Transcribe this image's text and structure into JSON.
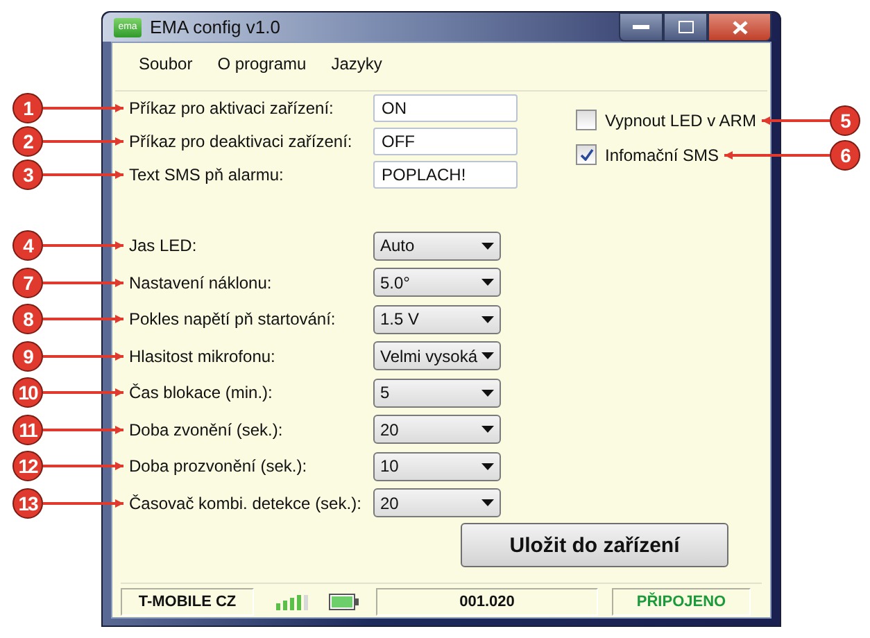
{
  "window": {
    "title": "EMA config v1.0",
    "icon_text": "ema"
  },
  "menu": [
    "Soubor",
    "O programu",
    "Jazyky"
  ],
  "text_fields": [
    {
      "callout": "1",
      "label": "Příkaz pro aktivaci zařízení:",
      "value": "ON"
    },
    {
      "callout": "2",
      "label": "Příkaz pro deaktivaci zařízení:",
      "value": "OFF"
    },
    {
      "callout": "3",
      "label": "Text SMS pň alarmu:",
      "value": "POPLACH!"
    }
  ],
  "checkboxes": [
    {
      "callout": "5",
      "label": "Vypnout LED v ARM",
      "checked": false
    },
    {
      "callout": "6",
      "label": "Infomační SMS",
      "checked": true
    }
  ],
  "dropdowns": [
    {
      "callout": "4",
      "label": "Jas LED:",
      "value": "Auto"
    },
    {
      "callout": "7",
      "label": "Nastavení náklonu:",
      "value": "5.0°"
    },
    {
      "callout": "8",
      "label": "Pokles napětí pň startování:",
      "value": "1.5 V"
    },
    {
      "callout": "9",
      "label": "Hlasitost mikrofonu:",
      "value": "Velmi vysoká"
    },
    {
      "callout": "10",
      "label": "Čas blokace (min.):",
      "value": "5"
    },
    {
      "callout": "11",
      "label": "Doba zvonění (sek.):",
      "value": "20"
    },
    {
      "callout": "12",
      "label": "Doba prozvonění (sek.):",
      "value": "10"
    },
    {
      "callout": "13",
      "label": "Časovač kombi. detekce (sek.):",
      "value": "20"
    }
  ],
  "save_button": "Uložit do zařízení",
  "status_bar": {
    "operator": "T-MOBILE CZ",
    "version": "001.020",
    "connection": "PŘIPOJENO"
  }
}
